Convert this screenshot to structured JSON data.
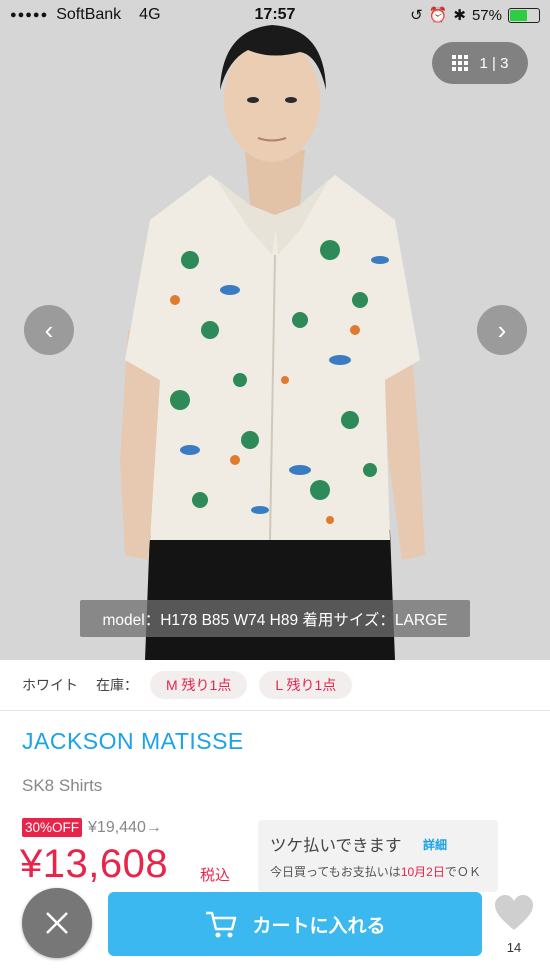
{
  "status_bar": {
    "signal": "●●●●●",
    "carrier": "SoftBank",
    "network": "4G",
    "time": "17:57",
    "battery_percent": "57%",
    "battery_level": 0.57
  },
  "gallery": {
    "current": "1",
    "separator": "|",
    "total": "3",
    "prev_icon": "chevron-left-icon",
    "next_icon": "chevron-right-icon",
    "model_info": "model：H178 B85 W74 H89 着用サイズ：LARGE"
  },
  "variant": {
    "color": "ホワイト",
    "stock_label": "在庫：",
    "sizes": [
      {
        "label": "M 残り1点"
      },
      {
        "label": "L 残り1点"
      }
    ]
  },
  "product": {
    "brand": "JACKSON MATISSE",
    "name": "SK8 Shirts",
    "discount": "30%OFF",
    "original_price": "¥19,440→",
    "sale_price": "¥13,608",
    "tax_label": "税込"
  },
  "tsuke": {
    "title": "ツケ払いできます",
    "detail_link": "詳細",
    "sub_prefix": "今日買ってもお支払いは",
    "sub_highlight": "10月2日",
    "sub_suffix": "でＯＫ"
  },
  "actions": {
    "close_icon": "close-icon",
    "cart_label": "カートに入れる",
    "cart_icon": "cart-icon",
    "favorite_icon": "heart-icon",
    "favorite_count": "14"
  },
  "colors": {
    "accent_blue": "#1aa3e8",
    "cart_blue": "#3cb8f0",
    "sale_red": "#e8244b",
    "battery_green": "#2ecc40"
  }
}
